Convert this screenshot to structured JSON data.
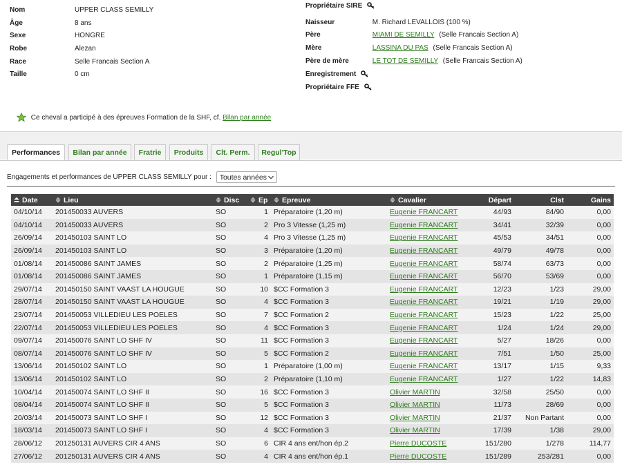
{
  "horse": {
    "left": [
      {
        "label": "Nom",
        "value": "UPPER CLASS SEMILLY"
      },
      {
        "label": "Âge",
        "value": "8 ans"
      },
      {
        "label": "Sexe",
        "value": "HONGRE"
      },
      {
        "label": "Robe",
        "value": "Alezan"
      },
      {
        "label": "Race",
        "value": "Selle Francais Section A"
      },
      {
        "label": "Taille",
        "value": "0 cm"
      }
    ],
    "proprietaire_sire_label": "Propriétaire SIRE",
    "naisseur_label": "Naisseur",
    "naisseur_value": "M. Richard LEVALLOIS (100 %)",
    "pere_label": "Père",
    "pere_link": "MIAMI DE SEMILLY",
    "pere_race": "(Selle Francais Section A)",
    "mere_label": "Mère",
    "mere_link": "LASSINA DU PAS",
    "mere_race": "(Selle Francais Section A)",
    "pere_mere_label": "Père de mère",
    "pere_mere_link": "LE TOT DE SEMILLY",
    "pere_mere_race": "(Selle Francais Section A)",
    "enregistrement_label": "Enregistrement",
    "proprietaire_ffe_label": "Propriétaire FFE"
  },
  "note": {
    "text": "Ce cheval a participé à des épreuves Formation de la SHF, cf.",
    "link": "Bilan par année"
  },
  "tabs": [
    {
      "label": "Performances",
      "active": true
    },
    {
      "label": "Bilan par année"
    },
    {
      "label": "Fratrie"
    },
    {
      "label": "Produits"
    },
    {
      "label": "Clt. Perm."
    },
    {
      "label": "Regul'Top"
    }
  ],
  "filter": {
    "label": "Engagements et performances de UPPER CLASS SEMILLY pour :",
    "selected": "Toutes années"
  },
  "table": {
    "headers": [
      "Date",
      "Lieu",
      "Disc",
      "Ep",
      "Epreuve",
      "Cavalier",
      "Départ",
      "Clst",
      "Gains"
    ],
    "rows": [
      [
        "04/10/14",
        "201450033 AUVERS",
        "SO",
        "1",
        "Préparatoire (1,20 m)",
        "Eugenie FRANCART",
        "44/93",
        "84/90",
        "0,00"
      ],
      [
        "04/10/14",
        "201450033 AUVERS",
        "SO",
        "2",
        "Pro 3 Vitesse (1,25 m)",
        "Eugenie FRANCART",
        "34/41",
        "32/39",
        "0,00"
      ],
      [
        "26/09/14",
        "201450103 SAINT LO",
        "SO",
        "4",
        "Pro 3 Vitesse (1,25 m)",
        "Eugenie FRANCART",
        "45/53",
        "34/51",
        "0,00"
      ],
      [
        "26/09/14",
        "201450103 SAINT LO",
        "SO",
        "3",
        "Préparatoire (1,20 m)",
        "Eugenie FRANCART",
        "49/79",
        "49/78",
        "0,00"
      ],
      [
        "01/08/14",
        "201450086 SAINT JAMES",
        "SO",
        "2",
        "Préparatoire (1,25 m)",
        "Eugenie FRANCART",
        "58/74",
        "63/73",
        "0,00"
      ],
      [
        "01/08/14",
        "201450086 SAINT JAMES",
        "SO",
        "1",
        "Préparatoire (1,15 m)",
        "Eugenie FRANCART",
        "56/70",
        "53/69",
        "0,00"
      ],
      [
        "29/07/14",
        "201450150 SAINT VAAST LA HOUGUE",
        "SO",
        "10",
        "$CC Formation 3",
        "Eugenie FRANCART",
        "12/23",
        "1/23",
        "29,00"
      ],
      [
        "28/07/14",
        "201450150 SAINT VAAST LA HOUGUE",
        "SO",
        "4",
        "$CC Formation 3",
        "Eugenie FRANCART",
        "19/21",
        "1/19",
        "29,00"
      ],
      [
        "23/07/14",
        "201450053 VILLEDIEU LES POELES",
        "SO",
        "7",
        "$CC Formation 2",
        "Eugenie FRANCART",
        "15/23",
        "1/22",
        "25,00"
      ],
      [
        "22/07/14",
        "201450053 VILLEDIEU LES POELES",
        "SO",
        "4",
        "$CC Formation 3",
        "Eugenie FRANCART",
        "1/24",
        "1/24",
        "29,00"
      ],
      [
        "09/07/14",
        "201450076 SAINT LO SHF IV",
        "SO",
        "11",
        "$CC Formation 3",
        "Eugenie FRANCART",
        "5/27",
        "18/26",
        "0,00"
      ],
      [
        "08/07/14",
        "201450076 SAINT LO SHF IV",
        "SO",
        "5",
        "$CC Formation 2",
        "Eugenie FRANCART",
        "7/51",
        "1/50",
        "25,00"
      ],
      [
        "13/06/14",
        "201450102 SAINT LO",
        "SO",
        "1",
        "Préparatoire (1,00 m)",
        "Eugenie FRANCART",
        "13/17",
        "1/15",
        "9,33"
      ],
      [
        "13/06/14",
        "201450102 SAINT LO",
        "SO",
        "2",
        "Préparatoire (1,10 m)",
        "Eugenie FRANCART",
        "1/27",
        "1/22",
        "14,83"
      ],
      [
        "10/04/14",
        "201450074 SAINT LO SHF II",
        "SO",
        "16",
        "$CC Formation 3",
        "Olivier MARTIN",
        "32/58",
        "25/50",
        "0,00"
      ],
      [
        "08/04/14",
        "201450074 SAINT LO SHF II",
        "SO",
        "5",
        "$CC Formation 3",
        "Olivier MARTIN",
        "11/73",
        "28/69",
        "0,00"
      ],
      [
        "20/03/14",
        "201450073 SAINT LO SHF I",
        "SO",
        "12",
        "$CC Formation 3",
        "Olivier MARTIN",
        "21/37",
        "Non Partant",
        "0,00"
      ],
      [
        "18/03/14",
        "201450073 SAINT LO SHF I",
        "SO",
        "4",
        "$CC Formation 3",
        "Olivier MARTIN",
        "17/39",
        "1/38",
        "29,00"
      ],
      [
        "28/06/12",
        "201250131 AUVERS CIR 4 ANS",
        "SO",
        "6",
        "CIR 4 ans ent/hon ép.2",
        "Pierre DUCOSTE",
        "151/280",
        "1/278",
        "114,77"
      ],
      [
        "27/06/12",
        "201250131 AUVERS CIR 4 ANS",
        "SO",
        "4",
        "CIR 4 ans ent/hon ép.1",
        "Pierre DUCOSTE",
        "151/289",
        "253/281",
        "0,00"
      ]
    ]
  },
  "colors": {
    "link": "#2e7d1e",
    "header_bg": "#444444"
  }
}
